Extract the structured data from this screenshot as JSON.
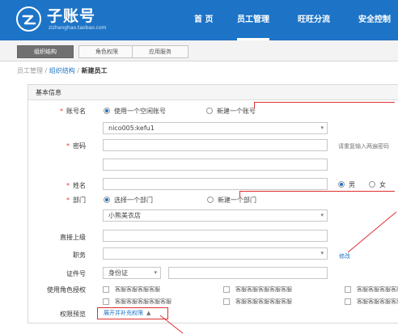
{
  "header": {
    "logo_title": "子账号",
    "logo_sub": "zizhanghao.taobao.com",
    "nav": [
      "首 页",
      "员工管理",
      "旺旺分流",
      "安全控制"
    ]
  },
  "tabs": [
    "组织结构",
    "角色权限",
    "应用服务"
  ],
  "breadcrumb": {
    "root": "员工管理",
    "sep1": "/",
    "section": "组织结构",
    "sep2": "/",
    "current": "新建员工"
  },
  "panel": {
    "title": "基本信息"
  },
  "form": {
    "account_label": "账号名",
    "account_opt1": "使用一个空闲账号",
    "account_opt2": "新建一个账号",
    "account_value": "nico005:kefu1",
    "password_label": "密码",
    "password_hint": "请重复输入两遍密码",
    "name_label": "姓名",
    "gender_male": "男",
    "gender_female": "女",
    "dept_label": "部门",
    "dept_opt1": "选择一个部门",
    "dept_opt2": "新建一个部门",
    "dept_value": "小熊美衣店",
    "supervisor_label": "直接上级",
    "position_label": "职务",
    "position_link": "修改",
    "id_label": "证件号",
    "id_type": "身份证",
    "role_label": "使用角色授权",
    "roles": [
      "客服客服客服客服",
      "客服客服客服客服客服",
      "客服客服客服客服客服",
      "客服客服客服客服客服",
      "客服客服客服客服客服",
      "客服客服客服客服客服"
    ],
    "preview_label": "权限预览",
    "expand_button": "展开并补充权限"
  },
  "colors": {
    "brand": "#1d74c7",
    "required": "#e33333",
    "annotation": "#e03030"
  }
}
